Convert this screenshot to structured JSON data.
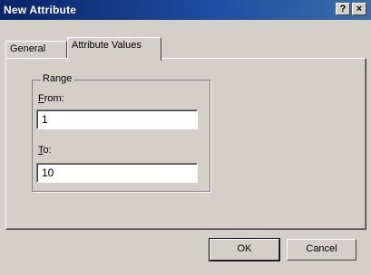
{
  "window": {
    "title": "New Attribute",
    "help_glyph": "?",
    "close_glyph": "×"
  },
  "tabs": [
    {
      "label": "General",
      "selected": false
    },
    {
      "label": "Attribute Values",
      "selected": true
    }
  ],
  "range_group": {
    "title": "Range",
    "from": {
      "label_accel": "F",
      "label_rest": "rom:",
      "value": "1"
    },
    "to": {
      "label_accel": "T",
      "label_rest": "o:",
      "value": "10"
    }
  },
  "buttons": {
    "ok": "OK",
    "cancel": "Cancel"
  }
}
